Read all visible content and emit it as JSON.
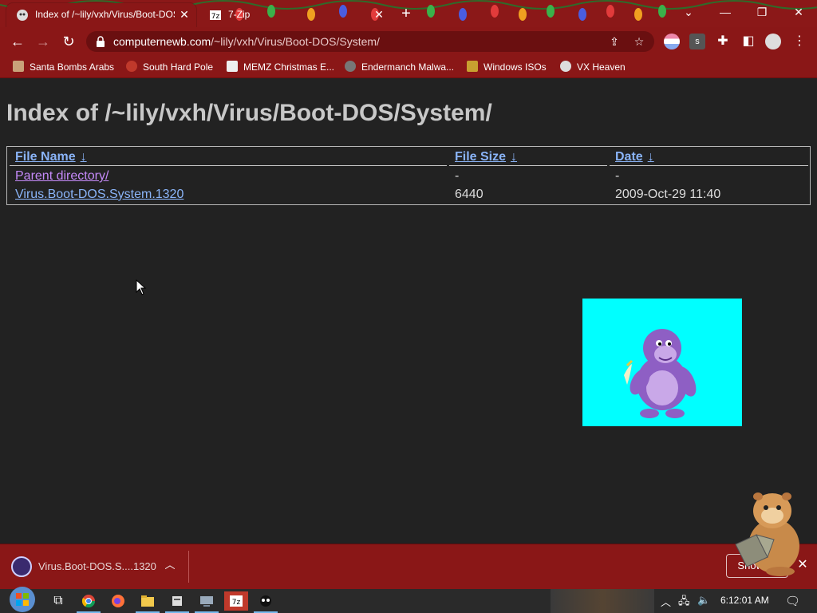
{
  "browser": {
    "tabs": [
      {
        "title": "Index of /~lily/vxh/Virus/Boot-DOS/System/",
        "active": true
      },
      {
        "title": "7-Zip",
        "active": false
      }
    ],
    "new_tab": "+",
    "window_controls": {
      "menu": "⌄",
      "minimize": "—",
      "restore": "❐",
      "close": "✕"
    },
    "url_host": "computernewb.com",
    "url_path": "/~lily/vxh/Virus/Boot-DOS/System/",
    "bookmarks": [
      {
        "label": "Santa Bombs Arabs",
        "icon": "santa-icon"
      },
      {
        "label": "South Hard Pole",
        "icon": "virus-icon"
      },
      {
        "label": "MEMZ Christmas E...",
        "icon": "memz-icon"
      },
      {
        "label": "Endermanch Malwa...",
        "icon": "enderman-icon"
      },
      {
        "label": "Windows ISOs",
        "icon": "buddha-icon"
      },
      {
        "label": "VX Heaven",
        "icon": "vx-icon"
      }
    ]
  },
  "page": {
    "heading": "Index of /~lily/vxh/Virus/Boot-DOS/System/",
    "columns": [
      {
        "label": "File Name",
        "sort": "↓"
      },
      {
        "label": "File Size",
        "sort": "↓"
      },
      {
        "label": "Date",
        "sort": "↓"
      }
    ],
    "rows": [
      {
        "name": "Parent directory/",
        "size": "-",
        "date": "-"
      },
      {
        "name": "Virus.Boot-DOS.System.1320",
        "size": "6440",
        "date": "2009-Oct-29 11:40"
      }
    ]
  },
  "download_shelf": {
    "filename": "Virus.Boot-DOS.S....1320",
    "show_all": "Show all",
    "close": "✕"
  },
  "taskbar": {
    "clock": "6:12:01 AM"
  },
  "colors": {
    "chrome_red": "#8a1717",
    "page_bg": "#222222",
    "link": "#8ab4f8",
    "visited": "#c58af9",
    "bonzi_bg": "#00ffff"
  }
}
